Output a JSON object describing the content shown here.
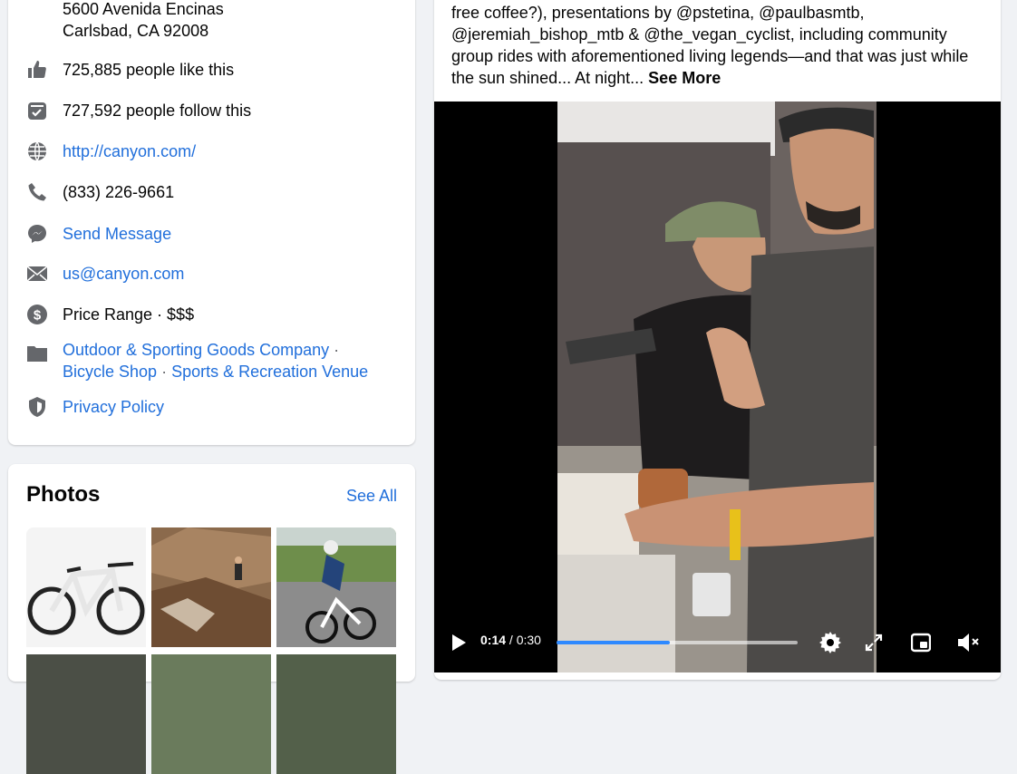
{
  "about": {
    "address_line1": "5600 Avenida Encinas",
    "address_line2": "Carlsbad, CA 92008",
    "likes": "725,885 people like this",
    "follows": "727,592 people follow this",
    "website": "http://canyon.com/",
    "phone": "(833) 226-9661",
    "message": "Send Message",
    "email": "us@canyon.com",
    "price_range": "Price Range · $$$",
    "categories": [
      "Outdoor & Sporting Goods Company",
      "Bicycle Shop",
      "Sports & Recreation Venue"
    ],
    "category_separator": " · ",
    "privacy": "Privacy Policy"
  },
  "photos": {
    "title": "Photos",
    "see_all": "See All"
  },
  "post": {
    "text": "free coffee?), presentations by @pstetina, @paulbasmtb, @jeremiah_bishop_mtb & @the_vegan_cyclist, including community group rides with aforementioned living legends—and that was just while the sun shined... At night...",
    "see_more": "See More"
  },
  "video": {
    "current_time": "0:14",
    "total_time": " / 0:30",
    "progress_fraction": 0.47
  },
  "colors": {
    "link": "#216fdb",
    "progress": "#2e89ff",
    "icon_gray": "#65676b"
  }
}
